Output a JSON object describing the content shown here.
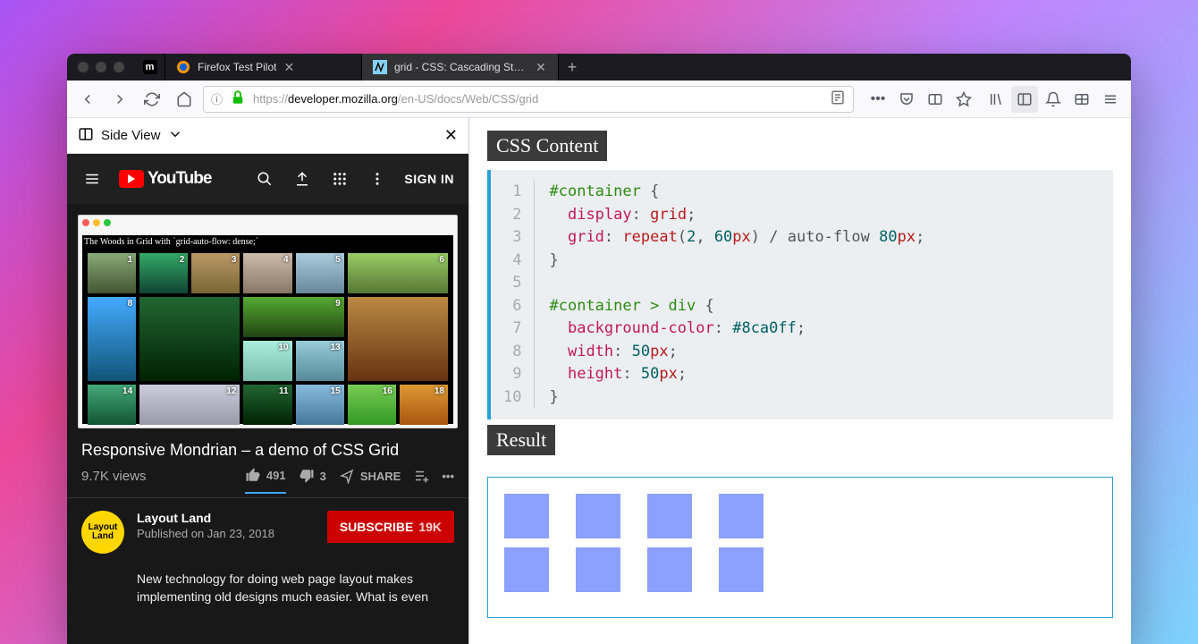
{
  "tabs": {
    "pinned_favicon": "m",
    "t1": {
      "title": "Firefox Test Pilot"
    },
    "t2": {
      "title": "grid - CSS: Cascading Style Sh"
    }
  },
  "url": {
    "scheme": "https://",
    "host": "developer.mozilla.org",
    "path": "/en-US/docs/Web/CSS/grid"
  },
  "sideview": {
    "label": "Side View"
  },
  "youtube": {
    "brand": "YouTube",
    "signin": "SIGN IN",
    "video_caption": "The Woods in Grid with `grid-auto-flow: dense;`",
    "title": "Responsive Mondrian – a demo of CSS Grid",
    "views": "9.7K views",
    "likes": "491",
    "dislikes": "3",
    "share": "SHARE",
    "channel": "Layout Land",
    "avatar_text": "Layout\nLand",
    "published": "Published on Jan 23, 2018",
    "subscribe": "SUBSCRIBE",
    "sub_count": "19K",
    "desc": "New technology for doing web page layout makes implementing old designs much easier. What is even",
    "gallery_nums": [
      "1",
      "2",
      "3",
      "4",
      "5",
      "6",
      "8",
      "9",
      "10",
      "11",
      "13",
      "14",
      "12",
      "15",
      "16",
      "18"
    ]
  },
  "mdn": {
    "h_css": "CSS Content",
    "h_result": "Result",
    "code": {
      "l1": {
        "sel": "#container",
        "brace": " {"
      },
      "l2": {
        "prop": "display",
        "val": "grid"
      },
      "l3": {
        "prop": "grid",
        "fn": "repeat",
        "arg1": "2",
        "arg2n": "60",
        "arg2u": "px",
        "mid": " / auto-flow ",
        "v2n": "80",
        "v2u": "px"
      },
      "l4": {
        "brace": "}"
      },
      "l6": {
        "sel": "#container > div",
        "brace": " {"
      },
      "l7": {
        "prop": "background-color",
        "val": "#8ca0ff"
      },
      "l8": {
        "prop": "width",
        "n": "50",
        "u": "px"
      },
      "l9": {
        "prop": "height",
        "n": "50",
        "u": "px"
      },
      "l10": {
        "brace": "}"
      }
    },
    "linenums": [
      "1",
      "2",
      "3",
      "4",
      "5",
      "6",
      "7",
      "8",
      "9",
      "10"
    ]
  }
}
